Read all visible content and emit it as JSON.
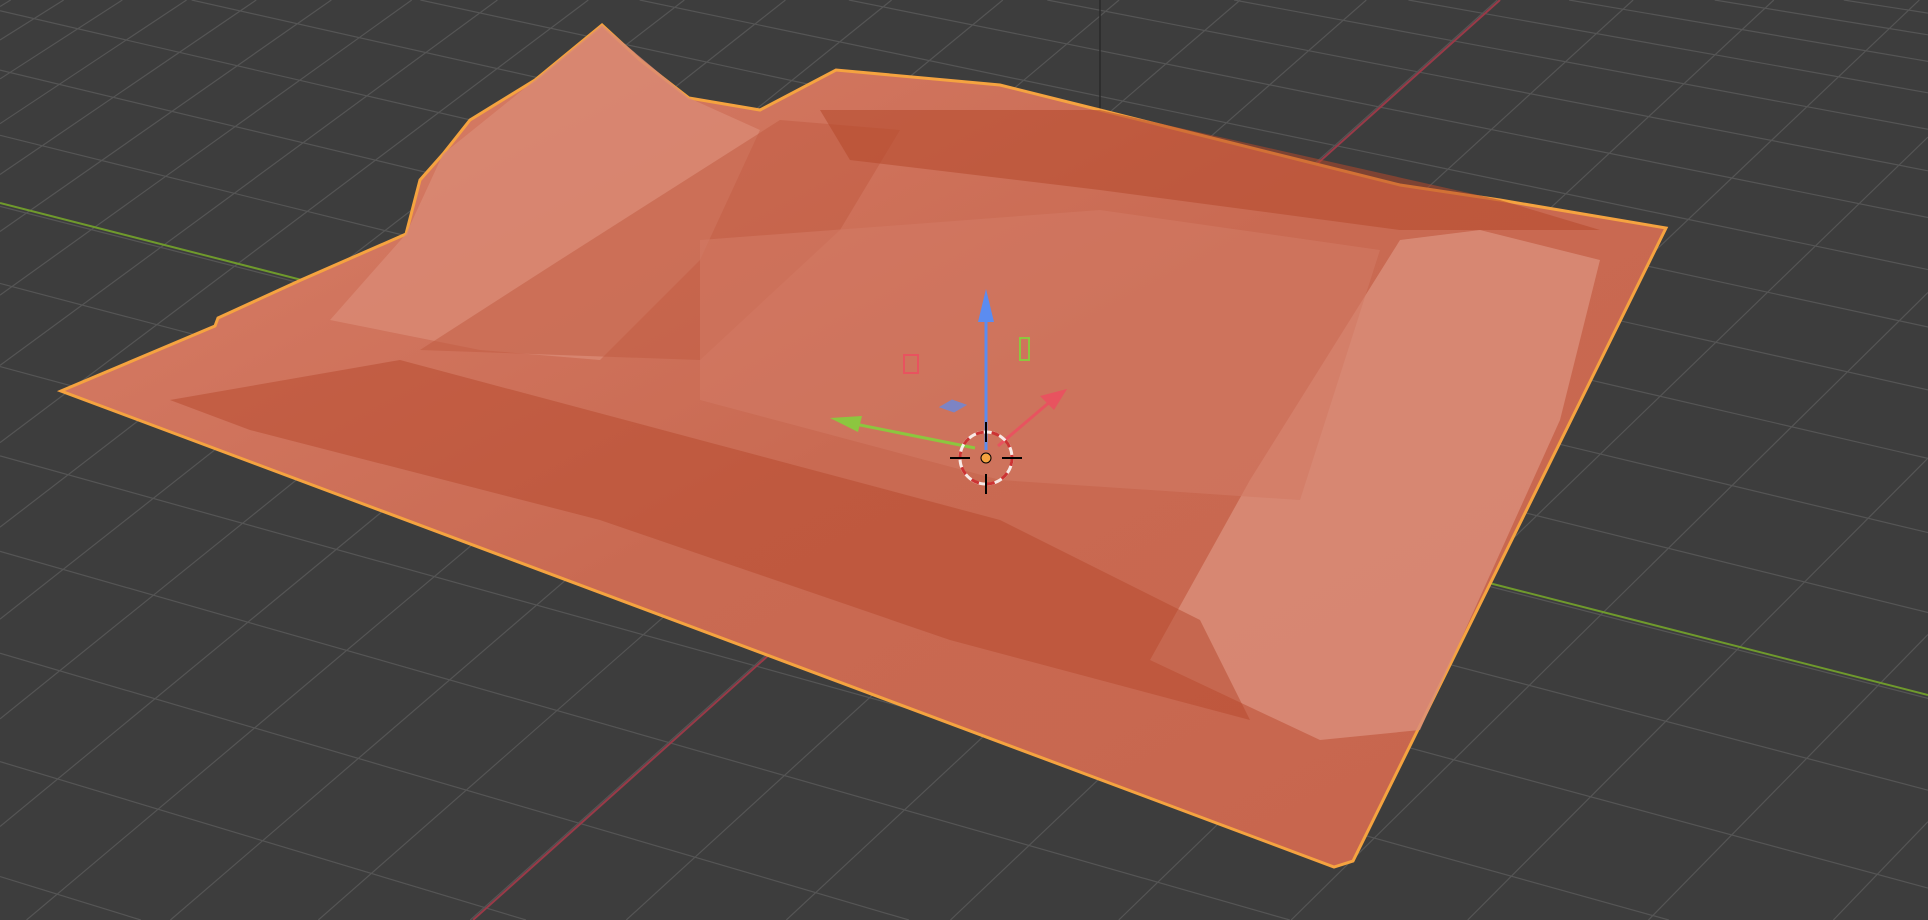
{
  "viewport": {
    "mode": "3d-viewport",
    "colors": {
      "background": "#3d3d3d",
      "grid": "#555555",
      "x_axis": "#9a3a48",
      "y_axis": "#6f9a2c",
      "z_axis": "#2a2a2a",
      "mesh_fill": "#c96a52",
      "mesh_dark": "#b5482c",
      "mesh_light": "#e6a08c",
      "selection_outline": "#f5a340",
      "gizmo_x": "#e8535f",
      "gizmo_y": "#8cc63f",
      "gizmo_z": "#5b8cf0"
    },
    "object": {
      "name_visible": false,
      "selected": true,
      "type": "terrain-mesh"
    },
    "gizmo": {
      "type": "move-gizmo"
    }
  }
}
